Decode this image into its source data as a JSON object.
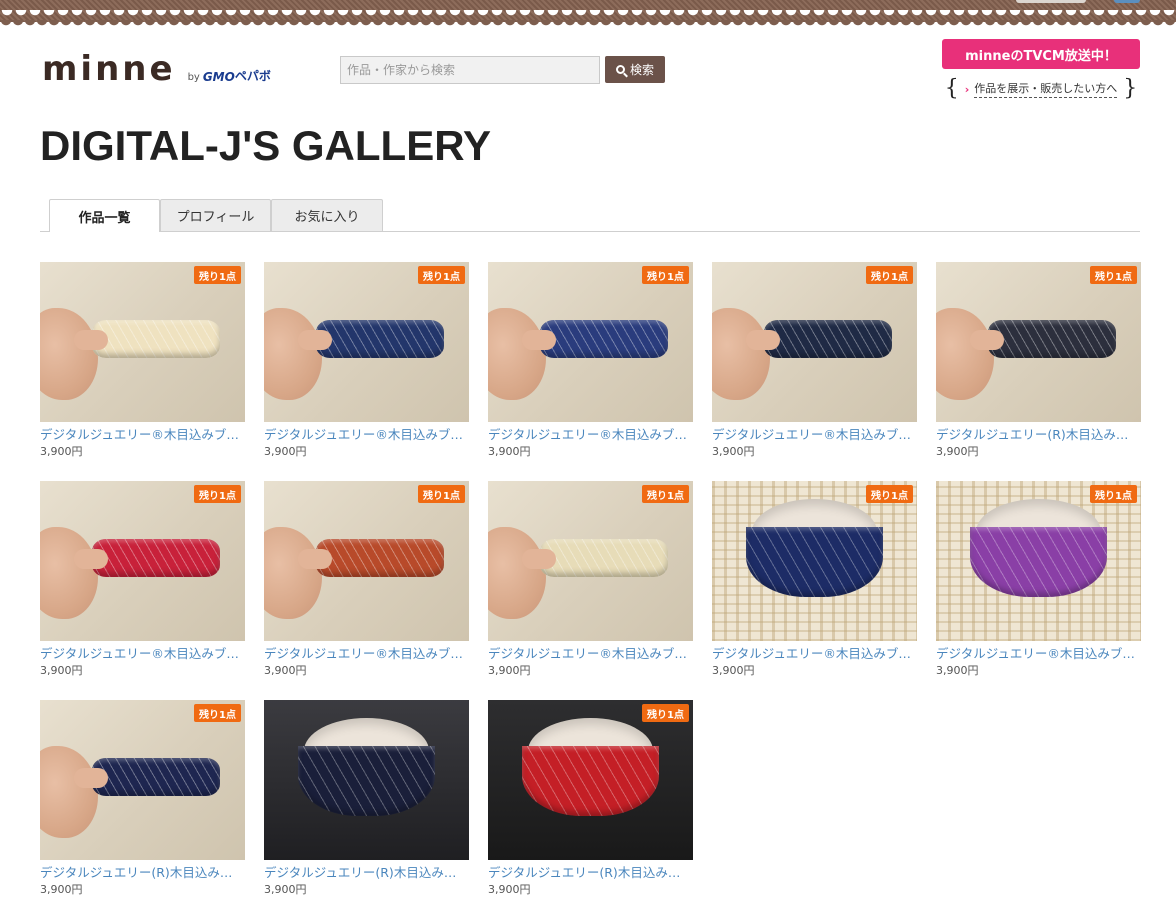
{
  "header": {
    "logo_word": "minne",
    "logo_by": "by",
    "logo_gmo": "GMO",
    "logo_pepabo": "ペパボ",
    "search_placeholder": "作品・作家から検索",
    "search_button_label": "検索",
    "tvcm_label": "minneのTVCM放送中！",
    "seller_link_label": "作品を展示・販売したい方へ"
  },
  "gallery": {
    "title": "DIGITAL-J'S GALLERY"
  },
  "tabs": [
    {
      "label": "作品一覧",
      "active": true
    },
    {
      "label": "プロフィール",
      "active": false
    },
    {
      "label": "お気に入り",
      "active": false
    }
  ],
  "items": [
    {
      "title": "デジタルジュエリー®木目込みブ…",
      "price": "3,900円",
      "badge": "残り1点",
      "scene": "wall",
      "band_color": "#efe2c0"
    },
    {
      "title": "デジタルジュエリー®木目込みブ…",
      "price": "3,900円",
      "badge": "残り1点",
      "scene": "wall",
      "band_color": "#23366b"
    },
    {
      "title": "デジタルジュエリー®木目込みブ…",
      "price": "3,900円",
      "badge": "残り1点",
      "scene": "wall",
      "band_color": "#2a3c7d"
    },
    {
      "title": "デジタルジュエリー®木目込みブ…",
      "price": "3,900円",
      "badge": "残り1点",
      "scene": "wall",
      "band_color": "#1f2a45"
    },
    {
      "title": "デジタルジュエリー(R)木目込み…",
      "price": "3,900円",
      "badge": "残り1点",
      "scene": "wall",
      "band_color": "#2c2f3d"
    },
    {
      "title": "デジタルジュエリー®木目込みブ…",
      "price": "3,900円",
      "badge": "残り1点",
      "scene": "wall",
      "band_color": "#c8213a"
    },
    {
      "title": "デジタルジュエリー®木目込みブ…",
      "price": "3,900円",
      "badge": "残り1点",
      "scene": "wall",
      "band_color": "#b84a2a"
    },
    {
      "title": "デジタルジュエリー®木目込みブ…",
      "price": "3,900円",
      "badge": "残り1点",
      "scene": "wall",
      "band_color": "#e7dcb8"
    },
    {
      "title": "デジタルジュエリー®木目込みブ…",
      "price": "3,900円",
      "badge": "残り1点",
      "scene": "mat",
      "band_color": "#1d2c66"
    },
    {
      "title": "デジタルジュエリー®木目込みブ…",
      "price": "3,900円",
      "badge": "残り1点",
      "scene": "mat",
      "band_color": "#8a3fa6"
    },
    {
      "title": "デジタルジュエリー(R)木目込み…",
      "price": "3,900円",
      "badge": "残り1点",
      "scene": "wall",
      "band_color": "#1e2650"
    },
    {
      "title": "デジタルジュエリー(R)木目込み…",
      "price": "3,900円",
      "badge": "",
      "scene": "dark",
      "band_color": "#1a1f3a"
    },
    {
      "title": "デジタルジュエリー(R)木目込み…",
      "price": "3,900円",
      "badge": "残り1点",
      "scene": "dark2",
      "band_color": "#c41f26"
    }
  ]
}
